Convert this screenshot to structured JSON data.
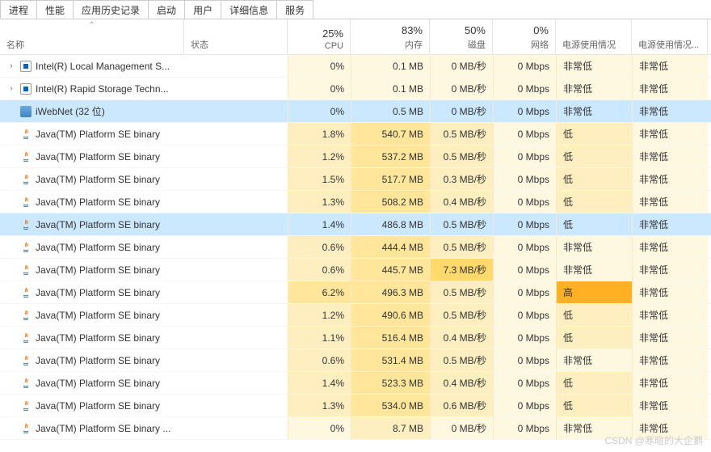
{
  "tabs": [
    "进程",
    "性能",
    "应用历史记录",
    "启动",
    "用户",
    "详细信息",
    "服务"
  ],
  "active_tab": 0,
  "columns": {
    "name": "名称",
    "status": "状态",
    "cpu": {
      "pct": "25%",
      "label": "CPU"
    },
    "mem": {
      "pct": "83%",
      "label": "内存"
    },
    "disk": {
      "pct": "50%",
      "label": "磁盘"
    },
    "net": {
      "pct": "0%",
      "label": "网络"
    },
    "pwr": "电源使用情况",
    "pwr2": "电源使用情况..."
  },
  "rows": [
    {
      "exp": true,
      "icon": "intel",
      "name": "Intel(R) Local Management S...",
      "cpu": "0%",
      "mem": "0.1 MB",
      "disk": "0 MB/秒",
      "net": "0 Mbps",
      "pwr": "非常低",
      "pwr2": "非常低",
      "h": {
        "cpu": 0,
        "mem": 0,
        "disk": 0,
        "net": 0,
        "pwr": 0,
        "pwr2": 0
      }
    },
    {
      "exp": true,
      "icon": "intel",
      "name": "Intel(R) Rapid Storage Techn...",
      "cpu": "0%",
      "mem": "0.1 MB",
      "disk": "0 MB/秒",
      "net": "0 Mbps",
      "pwr": "非常低",
      "pwr2": "非常低",
      "h": {
        "cpu": 0,
        "mem": 0,
        "disk": 0,
        "net": 0,
        "pwr": 0,
        "pwr2": 0
      }
    },
    {
      "exp": false,
      "icon": "iw",
      "name": "iWebNet (32 位)",
      "cpu": "0%",
      "mem": "0.5 MB",
      "disk": "0 MB/秒",
      "net": "0 Mbps",
      "pwr": "非常低",
      "pwr2": "非常低",
      "sel": true,
      "h": {
        "cpu": 0,
        "mem": 0,
        "disk": 0,
        "net": 0,
        "pwr": 0,
        "pwr2": 0
      }
    },
    {
      "exp": false,
      "icon": "java",
      "name": "Java(TM) Platform SE binary",
      "cpu": "1.8%",
      "mem": "540.7 MB",
      "disk": "0.5 MB/秒",
      "net": "0 Mbps",
      "pwr": "低",
      "pwr2": "非常低",
      "h": {
        "cpu": 1,
        "mem": 2,
        "disk": 1,
        "net": 0,
        "pwr": 1,
        "pwr2": 0
      }
    },
    {
      "exp": false,
      "icon": "java",
      "name": "Java(TM) Platform SE binary",
      "cpu": "1.2%",
      "mem": "537.2 MB",
      "disk": "0.5 MB/秒",
      "net": "0 Mbps",
      "pwr": "低",
      "pwr2": "非常低",
      "h": {
        "cpu": 1,
        "mem": 2,
        "disk": 1,
        "net": 0,
        "pwr": 1,
        "pwr2": 0
      }
    },
    {
      "exp": false,
      "icon": "java",
      "name": "Java(TM) Platform SE binary",
      "cpu": "1.5%",
      "mem": "517.7 MB",
      "disk": "0.3 MB/秒",
      "net": "0 Mbps",
      "pwr": "低",
      "pwr2": "非常低",
      "h": {
        "cpu": 1,
        "mem": 2,
        "disk": 1,
        "net": 0,
        "pwr": 1,
        "pwr2": 0
      }
    },
    {
      "exp": false,
      "icon": "java",
      "name": "Java(TM) Platform SE binary",
      "cpu": "1.3%",
      "mem": "508.2 MB",
      "disk": "0.4 MB/秒",
      "net": "0 Mbps",
      "pwr": "低",
      "pwr2": "非常低",
      "h": {
        "cpu": 1,
        "mem": 2,
        "disk": 1,
        "net": 0,
        "pwr": 1,
        "pwr2": 0
      }
    },
    {
      "exp": false,
      "icon": "java",
      "name": "Java(TM) Platform SE binary",
      "cpu": "1.4%",
      "mem": "486.8 MB",
      "disk": "0.5 MB/秒",
      "net": "0 Mbps",
      "pwr": "低",
      "pwr2": "非常低",
      "sel": true,
      "h": {
        "cpu": 1,
        "mem": 2,
        "disk": 1,
        "net": 0,
        "pwr": 1,
        "pwr2": 0
      }
    },
    {
      "exp": false,
      "icon": "java",
      "name": "Java(TM) Platform SE binary",
      "cpu": "0.6%",
      "mem": "444.4 MB",
      "disk": "0.5 MB/秒",
      "net": "0 Mbps",
      "pwr": "非常低",
      "pwr2": "非常低",
      "h": {
        "cpu": 1,
        "mem": 2,
        "disk": 1,
        "net": 0,
        "pwr": 0,
        "pwr2": 0
      }
    },
    {
      "exp": false,
      "icon": "java",
      "name": "Java(TM) Platform SE binary",
      "cpu": "0.6%",
      "mem": "445.7 MB",
      "disk": "7.3 MB/秒",
      "net": "0 Mbps",
      "pwr": "非常低",
      "pwr2": "非常低",
      "h": {
        "cpu": 1,
        "mem": 2,
        "disk": 3,
        "net": 0,
        "pwr": 0,
        "pwr2": 0
      }
    },
    {
      "exp": false,
      "icon": "java",
      "name": "Java(TM) Platform SE binary",
      "cpu": "6.2%",
      "mem": "496.3 MB",
      "disk": "0.5 MB/秒",
      "net": "0 Mbps",
      "pwr": "高",
      "pwr2": "非常低",
      "h": {
        "cpu": 2,
        "mem": 2,
        "disk": 1,
        "net": 0,
        "pwr": 4,
        "pwr2": 0
      }
    },
    {
      "exp": false,
      "icon": "java",
      "name": "Java(TM) Platform SE binary",
      "cpu": "1.2%",
      "mem": "490.6 MB",
      "disk": "0.5 MB/秒",
      "net": "0 Mbps",
      "pwr": "低",
      "pwr2": "非常低",
      "h": {
        "cpu": 1,
        "mem": 2,
        "disk": 1,
        "net": 0,
        "pwr": 1,
        "pwr2": 0
      }
    },
    {
      "exp": false,
      "icon": "java",
      "name": "Java(TM) Platform SE binary",
      "cpu": "1.1%",
      "mem": "516.4 MB",
      "disk": "0.4 MB/秒",
      "net": "0 Mbps",
      "pwr": "低",
      "pwr2": "非常低",
      "h": {
        "cpu": 1,
        "mem": 2,
        "disk": 1,
        "net": 0,
        "pwr": 1,
        "pwr2": 0
      }
    },
    {
      "exp": false,
      "icon": "java",
      "name": "Java(TM) Platform SE binary",
      "cpu": "0.6%",
      "mem": "531.4 MB",
      "disk": "0.5 MB/秒",
      "net": "0 Mbps",
      "pwr": "非常低",
      "pwr2": "非常低",
      "h": {
        "cpu": 1,
        "mem": 2,
        "disk": 1,
        "net": 0,
        "pwr": 0,
        "pwr2": 0
      }
    },
    {
      "exp": false,
      "icon": "java",
      "name": "Java(TM) Platform SE binary",
      "cpu": "1.4%",
      "mem": "523.3 MB",
      "disk": "0.4 MB/秒",
      "net": "0 Mbps",
      "pwr": "低",
      "pwr2": "非常低",
      "h": {
        "cpu": 1,
        "mem": 2,
        "disk": 1,
        "net": 0,
        "pwr": 1,
        "pwr2": 0
      }
    },
    {
      "exp": false,
      "icon": "java",
      "name": "Java(TM) Platform SE binary",
      "cpu": "1.3%",
      "mem": "534.0 MB",
      "disk": "0.6 MB/秒",
      "net": "0 Mbps",
      "pwr": "低",
      "pwr2": "非常低",
      "h": {
        "cpu": 1,
        "mem": 2,
        "disk": 1,
        "net": 0,
        "pwr": 1,
        "pwr2": 0
      }
    },
    {
      "exp": false,
      "icon": "java",
      "name": "Java(TM) Platform SE binary ...",
      "cpu": "0%",
      "mem": "8.7 MB",
      "disk": "0 MB/秒",
      "net": "0 Mbps",
      "pwr": "非常低",
      "pwr2": "非常低",
      "h": {
        "cpu": 0,
        "mem": 1,
        "disk": 0,
        "net": 0,
        "pwr": 0,
        "pwr2": 0
      }
    }
  ],
  "watermark": "CSDN @寒暄的大企鹅"
}
